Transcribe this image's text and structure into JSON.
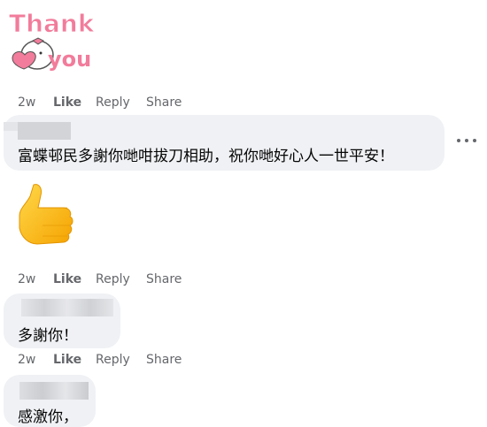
{
  "sticker": {
    "line1": "Thank",
    "line2": "you"
  },
  "actions": [
    {
      "time": "2w",
      "like": "Like",
      "reply": "Reply",
      "share": "Share"
    },
    {
      "time": "2w",
      "like": "Like",
      "reply": "Reply",
      "share": "Share"
    },
    {
      "time": "2w",
      "like": "Like",
      "reply": "Reply",
      "share": "Share"
    }
  ],
  "comments": [
    {
      "text": "富蝶邨民多謝你哋咁拔刀相助，祝你哋好心人一世平安！"
    },
    {
      "text": "多謝你！"
    },
    {
      "text": "感激你，"
    }
  ],
  "colors": {
    "sticker_pink": "#f27c9b",
    "bubble_bg": "#eff1f4",
    "meta_gray": "#65676b",
    "thumb_yellow": "#ffc629"
  }
}
